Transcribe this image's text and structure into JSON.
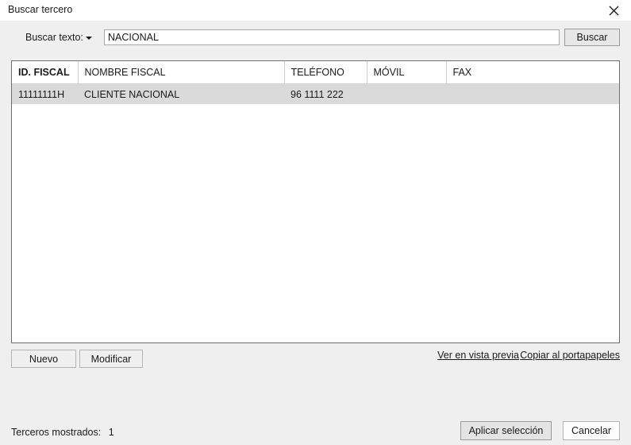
{
  "window": {
    "title": "Buscar tercero",
    "close_icon": "close-icon"
  },
  "search": {
    "label": "Buscar texto:",
    "dropdown_icon": "chevron-down-icon",
    "value": "NACIONAL",
    "placeholder": "",
    "button_label": "Buscar"
  },
  "table": {
    "columns": [
      {
        "key": "id_fiscal",
        "label": "ID. FISCAL",
        "sorted": true
      },
      {
        "key": "nombre_fiscal",
        "label": "NOMBRE FISCAL",
        "sorted": false
      },
      {
        "key": "telefono",
        "label": "TELÉFONO",
        "sorted": false
      },
      {
        "key": "movil",
        "label": "MÓVIL",
        "sorted": false
      },
      {
        "key": "fax",
        "label": "FAX",
        "sorted": false
      }
    ],
    "rows": [
      {
        "id_fiscal": "11111111H",
        "nombre_fiscal": "CLIENTE NACIONAL",
        "telefono": "96 1111 222",
        "movil": "",
        "fax": "",
        "selected": true
      }
    ]
  },
  "actions": {
    "nuevo_label": "Nuevo",
    "modificar_label": "Modificar",
    "preview_link": "Ver en vista previa",
    "clipboard_link": "Copiar al portapapeles"
  },
  "footer": {
    "status_label": "Terceros mostrados:",
    "status_count": "1",
    "apply_label": "Aplicar selección",
    "cancel_label": "Cancelar"
  },
  "colors": {
    "window_bg": "#efefef",
    "titlebar_bg": "#ffffff",
    "grid_bg": "#ffffff",
    "grid_border": "#6e6e6e",
    "row_selected": "#dadada",
    "text": "#1a1a1a"
  }
}
